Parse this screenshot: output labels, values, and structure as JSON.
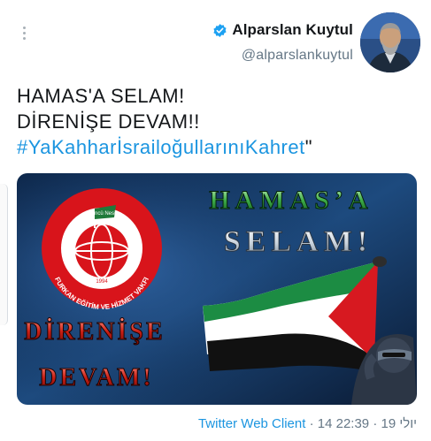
{
  "header": {
    "author_name": "Alparslan Kuytul",
    "author_handle": "@alparslankuytul",
    "verified_icon": "verified-badge-icon",
    "more_icon": "more-vertical-icon"
  },
  "tweet": {
    "line1": "HAMAS'A SELAM!",
    "line2": "DİRENİŞE DEVAM!!",
    "hashtag": "#YaKahharİsrailoğullarınıKahret",
    "trailing_quote": "\""
  },
  "media": {
    "poster_title_1": "HAMAS’A",
    "poster_title_2": "SELAM!",
    "poster_bottom_1": "DİRENİŞE",
    "poster_bottom_2": "DEVAM!",
    "logo_ring_text": "FURKAN EĞİTİM VE HİZMET VAKFI",
    "logo_flag_text": "Öncü Nesil",
    "logo_year": "1994"
  },
  "footer": {
    "client": "Twitter Web Client",
    "separator": " · ",
    "date": "14 יולי 19",
    "time": "22:39"
  },
  "colors": {
    "link": "#1b95e0",
    "text": "#14171a",
    "secondary": "#657786",
    "logo_red": "#d8141b",
    "flag_green": "#1e7a3a"
  }
}
